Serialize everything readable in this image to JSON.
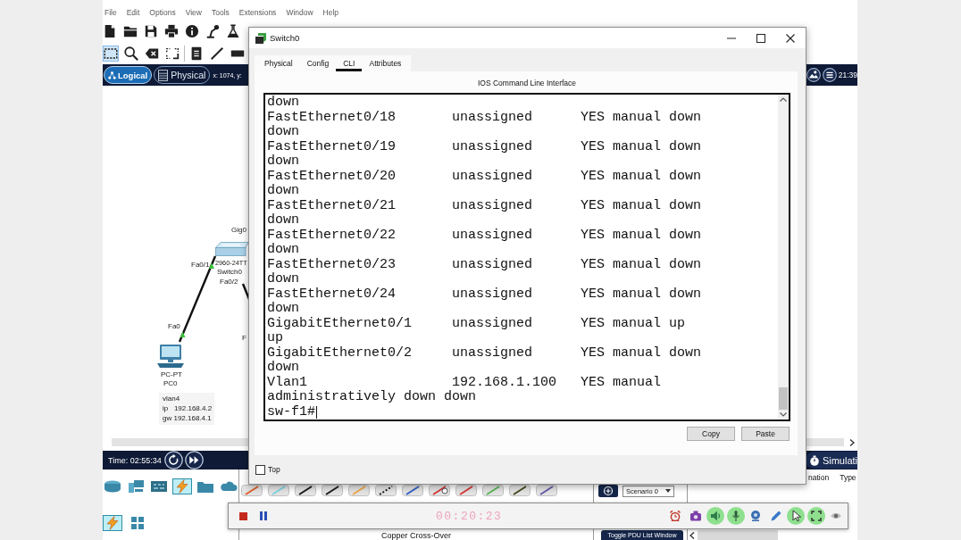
{
  "app": {
    "menu": [
      "File",
      "Edit",
      "Options",
      "View",
      "Tools",
      "Extensions",
      "Window",
      "Help"
    ],
    "edit_tools": [
      {
        "selected": true
      },
      {
        "selected": false
      },
      {
        "selected": false
      },
      {
        "selected": false
      },
      {
        "selected": false
      },
      {
        "selected": false
      },
      {
        "selected": false
      }
    ],
    "view_tabs": [
      {
        "label": "Logical",
        "selected": true
      },
      {
        "label": "Physical",
        "selected": false
      }
    ],
    "pointer_position": "x: 1074, y:",
    "clock": "21:39",
    "diagram": {
      "switch": {
        "uplink_port": "Gig0",
        "left_port": "Fa0/1",
        "model": "2960-24TT",
        "name": "Switch0",
        "lower_port": "Fa0/2"
      },
      "pc": {
        "port": "Fa0",
        "model": "PC-PT",
        "name": "PC0"
      },
      "other_port": "F",
      "note": [
        "vlan4",
        "ip   192.168.4.2",
        "gw 192.168.4.1"
      ]
    },
    "time": "Time: 02:55:34",
    "mode_tab": "Simulati",
    "device_categories": [
      {
        "selected": false
      },
      {
        "selected": false
      },
      {
        "selected": false
      },
      {
        "selected": true
      },
      {
        "selected": false
      },
      {
        "selected": false
      }
    ],
    "device_types": [
      {
        "selected": true
      },
      {
        "selected": false
      }
    ],
    "cable_caption": "Copper Cross-Over",
    "scenario": "Scenario 0",
    "pdu_button": "Toggle PDU List Window",
    "event_columns": [
      "nation",
      "Type"
    ]
  },
  "dialog": {
    "title": "Switch0",
    "tabs": [
      {
        "label": "Physical",
        "selected": false
      },
      {
        "label": "Config",
        "selected": false
      },
      {
        "label": "CLI",
        "selected": true
      },
      {
        "label": "Attributes",
        "selected": false
      }
    ],
    "heading": "IOS Command Line Interface",
    "terminal": [
      "down",
      "FastEthernet0/18       unassigned      YES manual down",
      "down",
      "FastEthernet0/19       unassigned      YES manual down",
      "down",
      "FastEthernet0/20       unassigned      YES manual down",
      "down",
      "FastEthernet0/21       unassigned      YES manual down",
      "down",
      "FastEthernet0/22       unassigned      YES manual down",
      "down",
      "FastEthernet0/23       unassigned      YES manual down",
      "down",
      "FastEthernet0/24       unassigned      YES manual down",
      "down",
      "GigabitEthernet0/1     unassigned      YES manual up",
      "up",
      "GigabitEthernet0/2     unassigned      YES manual down",
      "down",
      "Vlan1                  192.168.1.100   YES manual",
      "administratively down down",
      "sw-f1#"
    ],
    "buttons": [
      "Copy",
      "Paste"
    ],
    "top_option": {
      "label": "Top",
      "checked": false
    }
  },
  "recorder": {
    "timer": "00:20:23",
    "toggles": [
      {
        "on": false
      },
      {
        "on": false
      },
      {
        "on": true
      },
      {
        "on": true
      },
      {
        "on": false
      },
      {
        "on": false
      },
      {
        "on": true
      },
      {
        "on": true
      },
      {
        "on": false
      }
    ]
  }
}
